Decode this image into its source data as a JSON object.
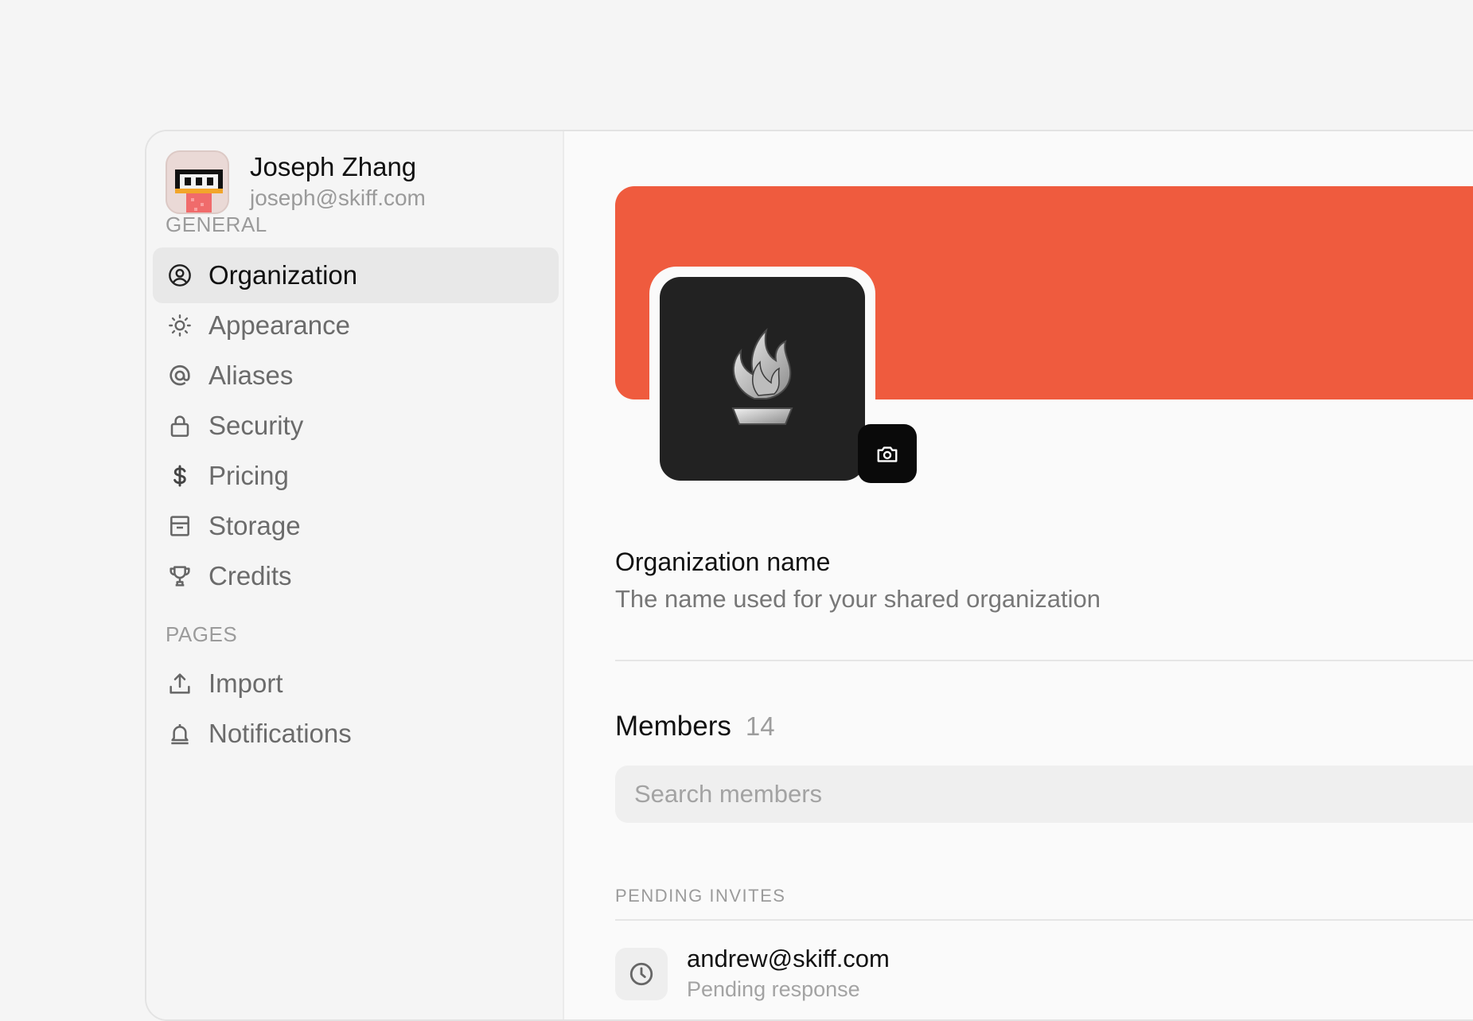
{
  "user": {
    "name": "Joseph Zhang",
    "email": "joseph@skiff.com"
  },
  "sidebar": {
    "general_label": "GENERAL",
    "pages_label": "PAGES",
    "general_items": [
      {
        "label": "Organization",
        "icon": "user-circle-icon",
        "active": true
      },
      {
        "label": "Appearance",
        "icon": "sun-icon",
        "active": false
      },
      {
        "label": "Aliases",
        "icon": "at-icon",
        "active": false
      },
      {
        "label": "Security",
        "icon": "lock-icon",
        "active": false
      },
      {
        "label": "Pricing",
        "icon": "dollar-icon",
        "active": false
      },
      {
        "label": "Storage",
        "icon": "archive-icon",
        "active": false
      },
      {
        "label": "Credits",
        "icon": "trophy-icon",
        "active": false
      }
    ],
    "pages_items": [
      {
        "label": "Import",
        "icon": "upload-icon"
      },
      {
        "label": "Notifications",
        "icon": "bell-icon"
      }
    ]
  },
  "main": {
    "banner_color": "#ef5b3e",
    "org_name": {
      "title": "Organization name",
      "description": "The name used for your shared organization"
    },
    "members": {
      "label": "Members",
      "count": "14",
      "search_placeholder": "Search members"
    },
    "pending": {
      "label": "PENDING INVITES",
      "invites": [
        {
          "email": "andrew@skiff.com",
          "status": "Pending response"
        }
      ]
    }
  }
}
